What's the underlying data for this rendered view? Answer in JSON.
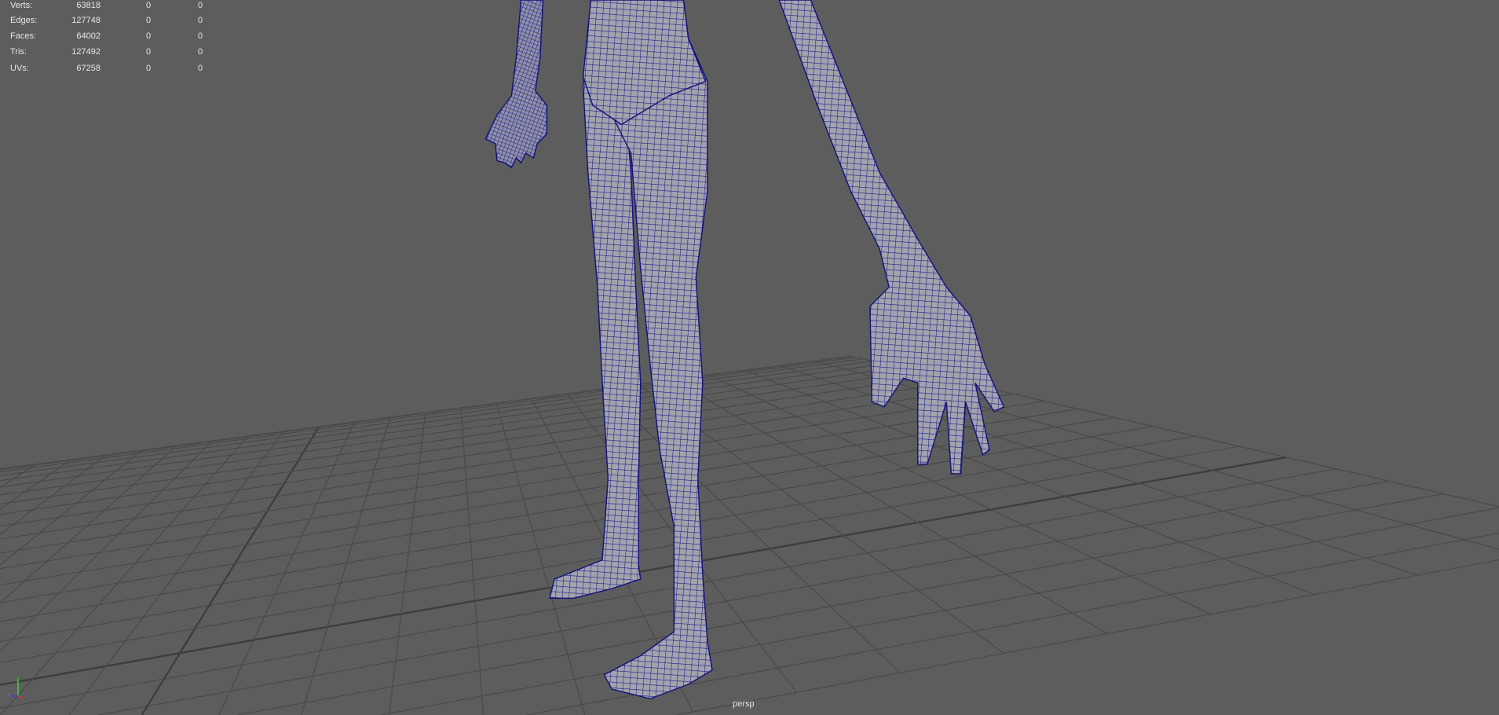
{
  "hud": {
    "stats": [
      {
        "label": "Verts:",
        "values": [
          "63818",
          "0",
          "0"
        ]
      },
      {
        "label": "Edges:",
        "values": [
          "127748",
          "0",
          "0"
        ]
      },
      {
        "label": "Faces:",
        "values": [
          "64002",
          "0",
          "0"
        ]
      },
      {
        "label": "Tris:",
        "values": [
          "127492",
          "0",
          "0"
        ]
      },
      {
        "label": "UVs:",
        "values": [
          "67258",
          "0",
          "0"
        ]
      }
    ],
    "camera_label": "persp",
    "axis_labels": {
      "y": "y",
      "z": "z",
      "x": "x"
    }
  },
  "colors": {
    "background": "#5d5d5d",
    "grid": "#4a4a4a",
    "wire": "#1a1a8a",
    "surface": "#9b9ba6"
  }
}
